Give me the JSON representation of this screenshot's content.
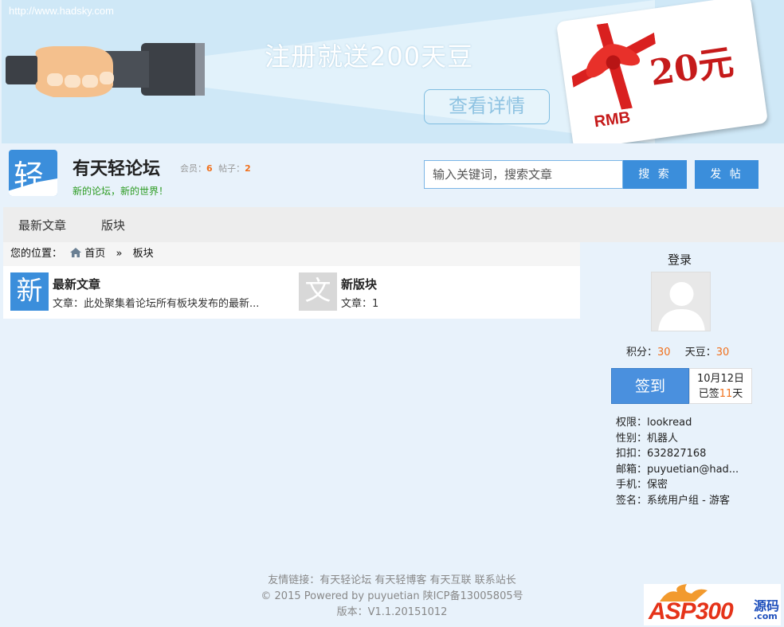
{
  "banner": {
    "url": "http://www.hadsky.com",
    "promo_text": "注册就送200天豆",
    "detail_button": "查看详情",
    "card_amount": "20元",
    "card_currency": "RMB"
  },
  "header": {
    "logo_char": "轻",
    "site_title": "有天轻论坛",
    "members_label": "会员：",
    "members_count": "6",
    "posts_label": "帖子：",
    "posts_count": "2",
    "slogan": "新的论坛，新的世界！",
    "search_placeholder": "输入关键词，搜索文章",
    "search_button": "搜 索",
    "post_button": "发 帖"
  },
  "nav": {
    "items": [
      {
        "label": "最新文章"
      },
      {
        "label": "版块"
      }
    ]
  },
  "breadcrumb": {
    "prefix": "您的位置：",
    "home": "首页",
    "separator": "»",
    "current": "板块"
  },
  "boards": [
    {
      "icon_char": "新",
      "icon_color": "#3b8edb",
      "title": "最新文章",
      "desc": "文章：此处聚集着论坛所有板块发布的最新..."
    },
    {
      "icon_char": "文",
      "icon_color": "#d8d8d8",
      "title": "新版块",
      "desc": "文章：1"
    }
  ],
  "sidebar": {
    "login_title": "登录",
    "points_label": "积分：",
    "points_value": "30",
    "beans_label": "天豆：",
    "beans_value": "30",
    "sign_button": "签到",
    "sign_date": "10月12日",
    "signed_prefix": "已签",
    "signed_days": "11",
    "signed_suffix": "天",
    "profile": [
      {
        "text": "权限：lookread"
      },
      {
        "text": "性别：机器人"
      },
      {
        "text": "扣扣：632827168"
      },
      {
        "text": "邮箱：puyuetian@had..."
      },
      {
        "text": "手机：保密"
      },
      {
        "text": "签名：系统用户组 - 游客"
      }
    ]
  },
  "footer": {
    "links": "友情链接：有天轻论坛 有天轻博客 有天互联 联系站长",
    "copyright": "© 2015 Powered by puyuetian 陕ICP备13005805号",
    "version": "版本：V1.1.20151012"
  },
  "watermark": {
    "text": "ASP300",
    "yuan": "源码",
    "com": ".com"
  },
  "colors": {
    "accent": "#3b8edb",
    "orange": "#f0711e",
    "green": "#2a9a1f"
  }
}
